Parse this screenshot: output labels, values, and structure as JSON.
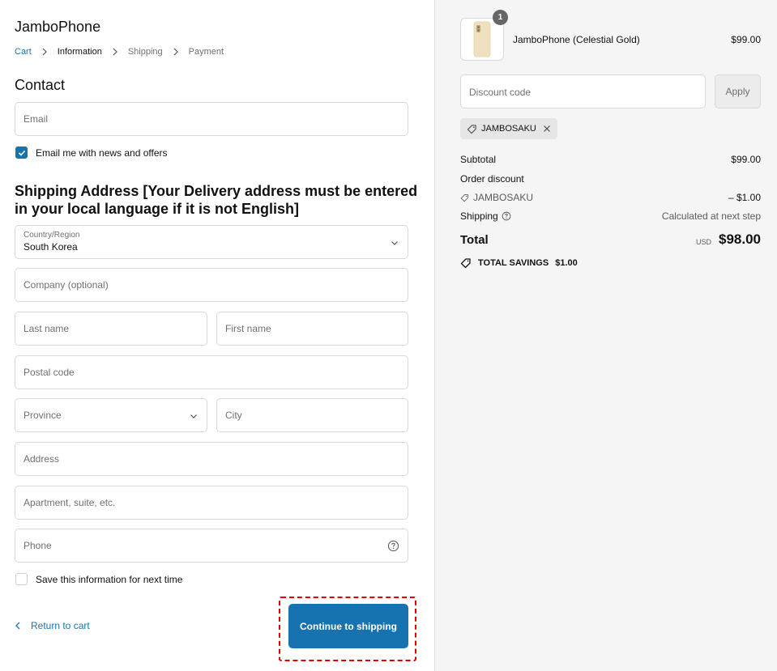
{
  "store": {
    "name": "JamboPhone"
  },
  "breadcrumbs": [
    {
      "label": "Cart"
    },
    {
      "label": "Information"
    },
    {
      "label": "Shipping"
    },
    {
      "label": "Payment"
    }
  ],
  "contact": {
    "heading": "Contact",
    "email_placeholder": "Email",
    "newsletter_label": "Email me with news and offers"
  },
  "shipping": {
    "heading": "Shipping Address [Your Delivery address must be entered in your local language if it is not English]",
    "country_label": "Country/Region",
    "country_value": "South Korea",
    "company_placeholder": "Company (optional)",
    "last_name_placeholder": "Last name",
    "first_name_placeholder": "First name",
    "postal_placeholder": "Postal code",
    "province_placeholder": "Province",
    "city_placeholder": "City",
    "address_placeholder": "Address",
    "apartment_placeholder": "Apartment, suite, etc.",
    "phone_placeholder": "Phone",
    "save_info_label": "Save this information for next time"
  },
  "footer": {
    "back_label": "Return to cart",
    "continue_label": "Continue to shipping"
  },
  "summary": {
    "product_name": "JamboPhone (Celestial Gold)",
    "product_price": "$99.00",
    "quantity_badge": "1",
    "discount_placeholder": "Discount code",
    "apply_label": "Apply",
    "applied_code": "JAMBOSAKU",
    "subtotal_label": "Subtotal",
    "subtotal_value": "$99.00",
    "order_discount_label": "Order discount",
    "discount_code_label": "JAMBOSAKU",
    "discount_value": "– $1.00",
    "shipping_label": "Shipping",
    "shipping_value": "Calculated at next step",
    "total_label": "Total",
    "currency": "USD",
    "total_value": "$98.00",
    "savings_label": "TOTAL SAVINGS",
    "savings_value": "$1.00"
  },
  "colors": {
    "accent": "#1773b0",
    "highlight_outline": "#e00000"
  },
  "icons": [
    "chevron-right-icon",
    "chevron-down-icon",
    "check-icon",
    "help-circle-icon",
    "chevron-left-icon",
    "tag-icon",
    "close-icon"
  ]
}
